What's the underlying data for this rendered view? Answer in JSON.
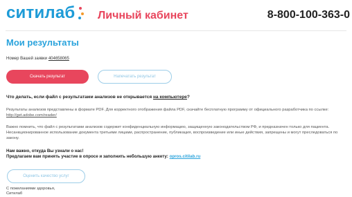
{
  "header": {
    "logo_text": "ситилаб",
    "cabinet_title": "Личный кабинет",
    "phone": "8-800-100-363-0"
  },
  "page_title": "Мои результаты",
  "order": {
    "label": "Номер Вашей заявки",
    "number": "404658065"
  },
  "buttons": {
    "download": "Скачать результат",
    "print": "Напечатать результат",
    "rate": "Оценить качество услуг"
  },
  "help": {
    "question": "Что делать, если файл с результатами анализов не открывается",
    "question_link": "на компьютере",
    "question_end": "?",
    "para1_text": "Результаты анализов представлены в формате PDF. Для корректного отображения файла PDF, скачайте бесплатную программу от официального разработчика по ссылке:",
    "para1_link": "http://get.adobe.com/reader/",
    "para2": "Важно помнить, что файл с результатами анализов содержит конфиденциальную информацию, защищенную законодательством РФ, и предназначен только для пациента. Несанкционированное использование документа третьими лицами, распространение, публикация, воспроизведение или иные действия, запрещены и могут преследоваться по закону."
  },
  "poll": {
    "line1": "Нам важно, откуда Вы узнали о нас!",
    "line2": "Предлагаем вам принять участие в опросе и заполнить небольшую анкету:",
    "link": "opros.citilab.ru"
  },
  "signature": {
    "line1": "С пожеланиями здоровья,",
    "line2": "Ситилаб"
  },
  "colors": {
    "brand_blue": "#1d9bd7",
    "brand_red": "#e8465d",
    "brand_orange": "#f39a2b"
  }
}
